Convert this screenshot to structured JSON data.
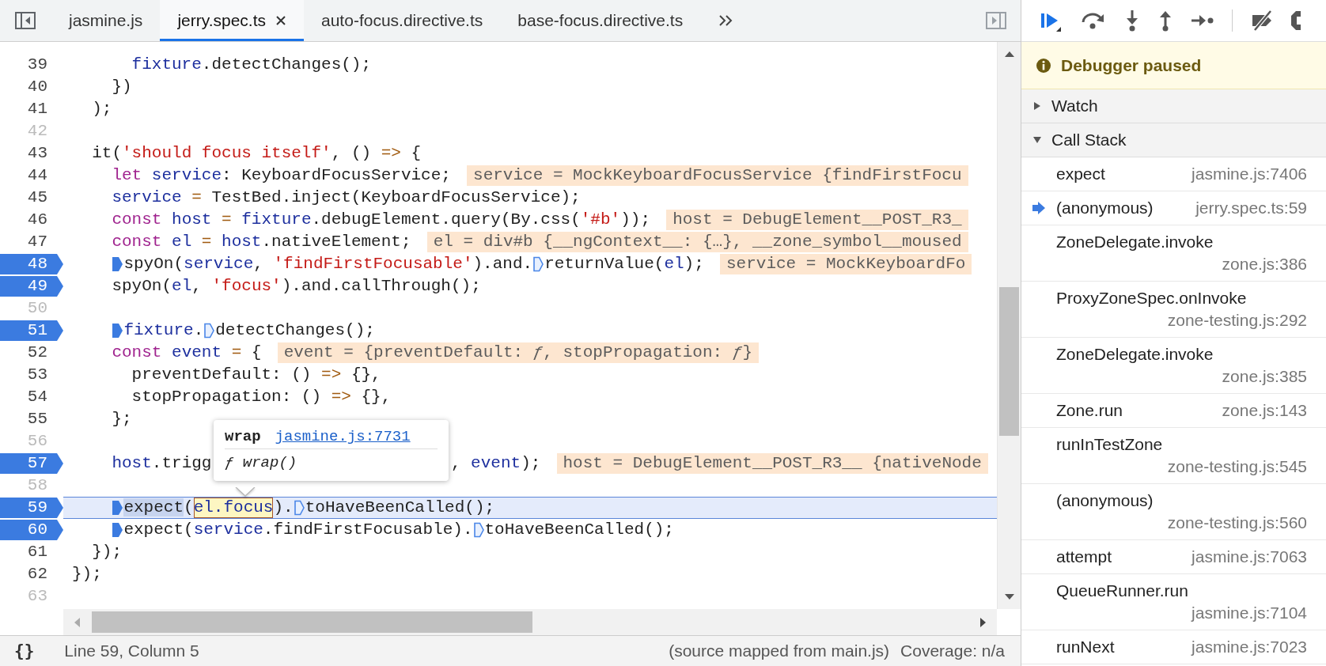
{
  "tabs": [
    {
      "label": "jasmine.js",
      "selected": false
    },
    {
      "label": "jerry.spec.ts",
      "selected": true
    },
    {
      "label": "auto-focus.directive.ts",
      "selected": false
    },
    {
      "label": "base-focus.directive.ts",
      "selected": false
    }
  ],
  "lines": [
    {
      "number": "39",
      "breakpoint": false,
      "current": false,
      "tokens": [
        {
          "kind": "variable",
          "text": "      fixture"
        },
        {
          "kind": "plain",
          "text": ".detectChanges();"
        }
      ]
    },
    {
      "number": "40",
      "breakpoint": false,
      "current": false,
      "tokens": [
        {
          "kind": "plain",
          "text": "    })"
        }
      ]
    },
    {
      "number": "41",
      "breakpoint": false,
      "current": false,
      "tokens": [
        {
          "kind": "plain",
          "text": "  );"
        }
      ]
    },
    {
      "number": "42",
      "breakpoint": false,
      "current": false
    },
    {
      "number": "43",
      "breakpoint": false,
      "current": false,
      "tokens": [
        {
          "kind": "plain",
          "text": "  it("
        },
        {
          "kind": "string",
          "text": "'should focus itself'"
        },
        {
          "kind": "plain",
          "text": ", () "
        },
        {
          "kind": "operator",
          "text": "=>"
        },
        {
          "kind": "plain",
          "text": " {"
        }
      ]
    },
    {
      "number": "44",
      "breakpoint": false,
      "current": false,
      "tokens": [
        {
          "kind": "keyword",
          "text": "    let "
        },
        {
          "kind": "variable",
          "text": "service"
        },
        {
          "kind": "plain",
          "text": ": KeyboardFocusService;"
        }
      ],
      "inline_value": "service = MockKeyboardFocusService {findFirstFocu"
    },
    {
      "number": "45",
      "breakpoint": false,
      "current": false,
      "tokens": [
        {
          "kind": "variable",
          "text": "    service "
        },
        {
          "kind": "operator",
          "text": "="
        },
        {
          "kind": "plain",
          "text": " TestBed.inject(KeyboardFocusService);"
        }
      ]
    },
    {
      "number": "46",
      "breakpoint": false,
      "current": false,
      "tokens": [
        {
          "kind": "keyword",
          "text": "    const "
        },
        {
          "kind": "variable",
          "text": "host "
        },
        {
          "kind": "operator",
          "text": "= "
        },
        {
          "kind": "variable",
          "text": "fixture"
        },
        {
          "kind": "plain",
          "text": ".debugElement.query(By.css("
        },
        {
          "kind": "string",
          "text": "'#b'"
        },
        {
          "kind": "plain",
          "text": "));"
        }
      ],
      "inline_value": "host = DebugElement__POST_R3_"
    },
    {
      "number": "47",
      "breakpoint": false,
      "current": false,
      "tokens": [
        {
          "kind": "keyword",
          "text": "    const "
        },
        {
          "kind": "variable",
          "text": "el "
        },
        {
          "kind": "operator",
          "text": "= "
        },
        {
          "kind": "variable",
          "text": "host"
        },
        {
          "kind": "plain",
          "text": ".nativeElement;"
        }
      ],
      "inline_value": "el = div#b {__ngContext__: {…}, __zone_symbol__moused"
    },
    {
      "number": "48",
      "breakpoint": true,
      "current": false,
      "tokens": [
        {
          "kind": "indent"
        },
        {
          "kind": "marker",
          "active": true
        },
        {
          "kind": "plain",
          "text": "spyOn("
        },
        {
          "kind": "variable",
          "text": "service"
        },
        {
          "kind": "plain",
          "text": ", "
        },
        {
          "kind": "string",
          "text": "'findFirstFocusable'"
        },
        {
          "kind": "plain",
          "text": ").and."
        },
        {
          "kind": "marker",
          "active": false
        },
        {
          "kind": "plain",
          "text": "returnValue("
        },
        {
          "kind": "variable",
          "text": "el"
        },
        {
          "kind": "plain",
          "text": ");"
        }
      ],
      "inline_value": "service = MockKeyboardFo"
    },
    {
      "number": "49",
      "breakpoint": true,
      "current": false,
      "tokens": [
        {
          "kind": "plain",
          "text": "    spyOn("
        },
        {
          "kind": "variable",
          "text": "el"
        },
        {
          "kind": "plain",
          "text": ", "
        },
        {
          "kind": "string",
          "text": "'focus'"
        },
        {
          "kind": "plain",
          "text": ").and.callThrough();"
        }
      ]
    },
    {
      "number": "50",
      "breakpoint": false,
      "current": false
    },
    {
      "number": "51",
      "breakpoint": true,
      "current": false,
      "tokens": [
        {
          "kind": "indent"
        },
        {
          "kind": "marker",
          "active": true
        },
        {
          "kind": "variable",
          "text": "fixture"
        },
        {
          "kind": "plain",
          "text": "."
        },
        {
          "kind": "marker",
          "active": false
        },
        {
          "kind": "plain",
          "text": "detectChanges();"
        }
      ]
    },
    {
      "number": "52",
      "breakpoint": false,
      "current": false,
      "tokens": [
        {
          "kind": "keyword",
          "text": "    const "
        },
        {
          "kind": "variable",
          "text": "event "
        },
        {
          "kind": "operator",
          "text": "="
        },
        {
          "kind": "plain",
          "text": " {"
        }
      ],
      "inline_value": "event = {preventDefault: *ƒ*, stopPropagation: *ƒ*}"
    },
    {
      "number": "53",
      "breakpoint": false,
      "current": false,
      "tokens": [
        {
          "kind": "plain",
          "text": "      preventDefault: () "
        },
        {
          "kind": "operator",
          "text": "=>"
        },
        {
          "kind": "plain",
          "text": " {},"
        }
      ]
    },
    {
      "number": "54",
      "breakpoint": false,
      "current": false,
      "tokens": [
        {
          "kind": "plain",
          "text": "      stopPropagation: () "
        },
        {
          "kind": "operator",
          "text": "=>"
        },
        {
          "kind": "plain",
          "text": " {},"
        }
      ]
    },
    {
      "number": "55",
      "breakpoint": false,
      "current": false,
      "tokens": [
        {
          "kind": "plain",
          "text": "    };"
        }
      ]
    },
    {
      "number": "56",
      "breakpoint": false,
      "current": false
    },
    {
      "number": "57",
      "breakpoint": true,
      "current": false,
      "tokens": [
        {
          "kind": "variable",
          "text": "    host"
        },
        {
          "kind": "plain",
          "text": ".trigg"
        },
        {
          "kind": "covered"
        },
        {
          "kind": "plain",
          "text": ", "
        },
        {
          "kind": "variable",
          "text": "event"
        },
        {
          "kind": "plain",
          "text": ");"
        }
      ],
      "inline_value": "host = DebugElement__POST_R3__ {nativeNode"
    },
    {
      "number": "58",
      "breakpoint": false,
      "current": false
    },
    {
      "number": "59",
      "breakpoint": true,
      "current": true,
      "tokens": [
        {
          "kind": "indent"
        },
        {
          "kind": "marker",
          "active": true
        },
        {
          "kind": "selection",
          "text": "expect"
        },
        {
          "kind": "plain",
          "text": "("
        },
        {
          "kind": "hover",
          "text": "el.focus"
        },
        {
          "kind": "plain",
          "text": ")."
        },
        {
          "kind": "marker",
          "active": false
        },
        {
          "kind": "plain",
          "text": "toHaveBeenCalled();"
        }
      ]
    },
    {
      "number": "60",
      "breakpoint": true,
      "current": false,
      "tokens": [
        {
          "kind": "indent"
        },
        {
          "kind": "marker",
          "active": true
        },
        {
          "kind": "plain",
          "text": "expect("
        },
        {
          "kind": "variable",
          "text": "service"
        },
        {
          "kind": "plain",
          "text": ".findFirstFocusable)."
        },
        {
          "kind": "marker",
          "active": false
        },
        {
          "kind": "plain",
          "text": "toHaveBeenCalled();"
        }
      ]
    },
    {
      "number": "61",
      "breakpoint": false,
      "current": false,
      "tokens": [
        {
          "kind": "plain",
          "text": "  });"
        }
      ]
    },
    {
      "number": "62",
      "breakpoint": false,
      "current": false,
      "tokens": [
        {
          "kind": "plain",
          "text": "});"
        }
      ]
    },
    {
      "number": "63",
      "breakpoint": false,
      "current": false
    }
  ],
  "tooltip": {
    "name": "wrap",
    "location": "jasmine.js:7731",
    "signature": "ƒ wrap()"
  },
  "status_bar": {
    "format_button": "{}",
    "position": "Line 59, Column 5",
    "source_map": "(source mapped from main.js)",
    "coverage": "Coverage: n/a"
  },
  "paused_banner": "Debugger paused",
  "sections": [
    {
      "title": "Watch",
      "expanded": false
    },
    {
      "title": "Call Stack",
      "expanded": true
    }
  ],
  "frames": [
    {
      "name": "expect",
      "location": "jasmine.js:7406",
      "selected": false
    },
    {
      "name": "(anonymous)",
      "location": "jerry.spec.ts:59",
      "selected": true
    },
    {
      "name": "ZoneDelegate.invoke",
      "location": "zone.js:386",
      "selected": false
    },
    {
      "name": "ProxyZoneSpec.onInvoke",
      "location": "zone-testing.js:292",
      "selected": false
    },
    {
      "name": "ZoneDelegate.invoke",
      "location": "zone.js:385",
      "selected": false
    },
    {
      "name": "Zone.run",
      "location": "zone.js:143",
      "selected": false
    },
    {
      "name": "runInTestZone",
      "location": "zone-testing.js:545",
      "selected": false
    },
    {
      "name": "(anonymous)",
      "location": "zone-testing.js:560",
      "selected": false
    },
    {
      "name": "attempt",
      "location": "jasmine.js:7063",
      "selected": false
    },
    {
      "name": "QueueRunner.run",
      "location": "jasmine.js:7104",
      "selected": false
    },
    {
      "name": "runNext",
      "location": "jasmine.js:7023",
      "selected": false
    }
  ]
}
